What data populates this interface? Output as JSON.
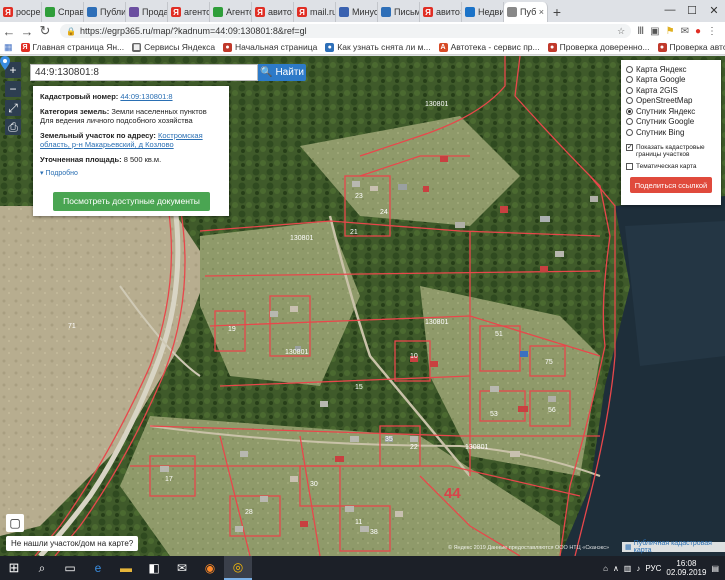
{
  "tabs": [
    {
      "label": "росре",
      "icon": "yandex",
      "color": "#e02e24"
    },
    {
      "label": "Справ",
      "icon": "y-green",
      "color": "#2f9e3a"
    },
    {
      "label": "Публи",
      "icon": "arrow",
      "color": "#2e6fb8"
    },
    {
      "label": "Прода",
      "icon": "doc",
      "color": "#6b4fa0"
    },
    {
      "label": "агентс",
      "icon": "yandex",
      "color": "#e02e24"
    },
    {
      "label": "Агентство",
      "icon": "y-green",
      "color": "#2f9e3a"
    },
    {
      "label": "авито",
      "icon": "yandex",
      "color": "#e02e24"
    },
    {
      "label": "mail.ru",
      "icon": "yandex",
      "color": "#e02e24"
    },
    {
      "label": "Минус",
      "icon": "flag",
      "color": "#3a62b0"
    },
    {
      "label": "Письм",
      "icon": "mail",
      "color": "#2e6fb8"
    },
    {
      "label": "авито",
      "icon": "yandex",
      "color": "#e02e24"
    },
    {
      "label": "Недви",
      "icon": "star",
      "color": "#1b73c8"
    },
    {
      "label": "Пуб",
      "icon": "doc",
      "color": "#888",
      "active": true
    }
  ],
  "window_controls": {
    "minimize": "—",
    "maximize": "☐",
    "close": "✕"
  },
  "address": {
    "url": "https://egrp365.ru/map/?kadnum=44:09:130801:8&ref=gl",
    "lock": "🔒"
  },
  "bookmarks": [
    {
      "label": "Главная страница Ян...",
      "color": "#e02e24",
      "glyph": "Я"
    },
    {
      "label": "Сервисы Яндекса",
      "color": "#666",
      "glyph": "▦"
    },
    {
      "label": "Начальная страница",
      "color": "#c0392b",
      "glyph": "●"
    },
    {
      "label": "Как узнать снята ли м...",
      "color": "#2e6fb8",
      "glyph": "●"
    },
    {
      "label": "Автотека - сервис пр...",
      "color": "#d64a26",
      "glyph": "A"
    },
    {
      "label": "Проверка доверенно...",
      "color": "#c0392b",
      "glyph": "●"
    },
    {
      "label": "Проверка автомобиля",
      "color": "#c0392b",
      "glyph": "●"
    },
    {
      "label": "Поиск залога на маш...",
      "color": "#c0392b",
      "glyph": "●"
    }
  ],
  "search": {
    "value": "44:9:130801:8",
    "button": "Найти"
  },
  "map_tools": {
    "zoom_in": "+",
    "zoom_out": "−",
    "measure": "⤢",
    "print": "⎙"
  },
  "info": {
    "kad_label": "Кадастровый номер:",
    "kad_value": "44:09:130801:8",
    "cat_label": "Категория земель:",
    "cat_value": "Земли населенных пунктов Для ведения личного подсобного хозяйства",
    "addr_label": "Земельный участок по адресу:",
    "addr_value": "Костромская область, р-н Макарьевский, д Козлово",
    "area_label": "Уточненная площадь:",
    "area_value": "8 500 кв.м.",
    "more": "▾ Подробно",
    "docs_button": "Посмотреть доступные документы"
  },
  "layers": {
    "options": [
      {
        "label": "Карта Яндекс",
        "on": false
      },
      {
        "label": "Карта Google",
        "on": false
      },
      {
        "label": "Карта 2GIS",
        "on": false
      },
      {
        "label": "OpenStreetMap",
        "on": false
      },
      {
        "label": "Спутник Яндекс",
        "on": true
      },
      {
        "label": "Спутник Google",
        "on": false
      },
      {
        "label": "Спутник Bing",
        "on": false
      }
    ],
    "cadastral": "Показать кадастровые границы участков",
    "cadastral_checked": true,
    "thematic": "Тематическая карта",
    "thematic_checked": false,
    "share": "Поделиться ссылкой"
  },
  "map_labels": {
    "q1": "130801",
    "q2": "130801",
    "q3": "130801",
    "q4": "130801",
    "q5": "130801",
    "big": "44",
    "p23": "23",
    "p24": "24",
    "p21": "21",
    "p19": "19",
    "p10": "10",
    "p15": "15",
    "p51": "51",
    "p75": "75",
    "p53": "53",
    "p56": "56",
    "p35": "35",
    "p22": "22",
    "p17": "17",
    "p30": "30",
    "p11": "11",
    "p28": "28",
    "p38": "38",
    "p71": "71"
  },
  "bottom": {
    "not_found": "Не нашли участок/дом на карте?",
    "pkk": "Публичная кадастровая карта",
    "copyright": "© Яндекс 2019  Данные предоставляются ООО НТЦ «Сканэкс»"
  },
  "taskbar": {
    "language": "РУС",
    "time": "16:08",
    "date": "02.09.2019"
  },
  "colors": {
    "accent_blue": "#2d7ac8",
    "docs_green": "#4aa552",
    "share_red": "#e04a3c",
    "cadastral_lines": "#e8474b"
  }
}
